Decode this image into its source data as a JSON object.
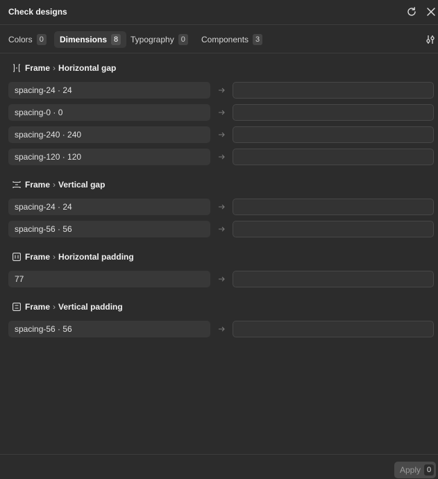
{
  "window": {
    "title": "Check designs"
  },
  "tabs": [
    {
      "label": "Colors",
      "count": "0"
    },
    {
      "label": "Dimensions",
      "count": "8"
    },
    {
      "label": "Typography",
      "count": "0"
    },
    {
      "label": "Components",
      "count": "3"
    }
  ],
  "active_tab": "Dimensions",
  "icons": {
    "refresh": "refresh-icon",
    "close": "close-icon",
    "filter": "filter-sliders-icon",
    "arrow": "arrow-right-icon",
    "horizontal_gap": "horizontal-gap-icon",
    "vertical_gap": "vertical-gap-icon",
    "horizontal_padding": "horizontal-padding-icon",
    "vertical_padding": "vertical-padding-icon"
  },
  "groups": [
    {
      "parent": "Frame",
      "separator": "›",
      "property": "Horizontal gap",
      "rows": [
        {
          "value": "spacing-24 · 24",
          "replacement": ""
        },
        {
          "value": "spacing-0 · 0",
          "replacement": ""
        },
        {
          "value": "spacing-240 · 240",
          "replacement": ""
        },
        {
          "value": "spacing-120 · 120",
          "replacement": ""
        }
      ]
    },
    {
      "parent": "Frame",
      "separator": "›",
      "property": "Vertical gap",
      "rows": [
        {
          "value": "spacing-24 · 24",
          "replacement": ""
        },
        {
          "value": "spacing-56 · 56",
          "replacement": ""
        }
      ]
    },
    {
      "parent": "Frame",
      "separator": "›",
      "property": "Horizontal padding",
      "rows": [
        {
          "value": "77",
          "replacement": ""
        }
      ]
    },
    {
      "parent": "Frame",
      "separator": "›",
      "property": "Vertical padding",
      "rows": [
        {
          "value": "spacing-56 · 56",
          "replacement": ""
        }
      ]
    }
  ],
  "footer": {
    "apply_label": "Apply",
    "apply_count": "0"
  },
  "colors": {
    "background": "#2c2c2c",
    "field": "#383838",
    "text": "#e6e6e6"
  }
}
